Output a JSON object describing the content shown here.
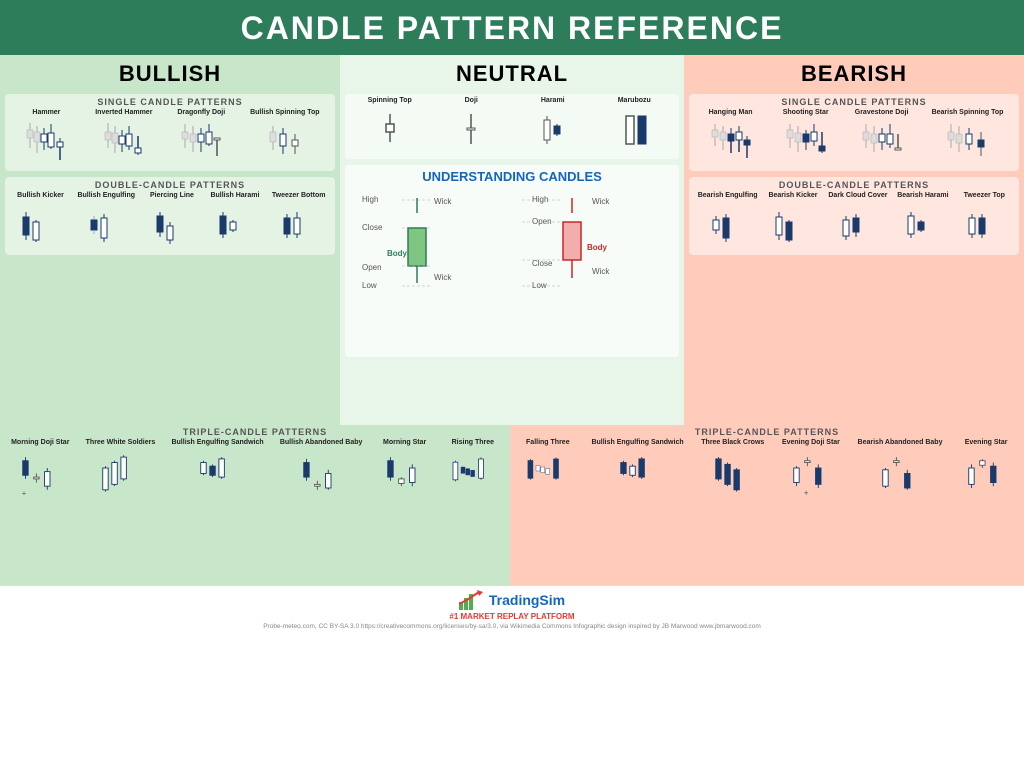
{
  "header": {
    "title": "CANDLE PATTERN REFERENCE"
  },
  "columns": {
    "bullish": {
      "label": "BULLISH",
      "single_title": "SINGLE CANDLE PATTERNS",
      "double_title": "DOUBLE-CANDLE PATTERNS",
      "single_patterns": [
        "Hammer",
        "Inverted Hammer",
        "Dragonfly Doji",
        "Bullish Spinning Top"
      ],
      "double_patterns": [
        "Bullish Kicker",
        "Bullish Engulfing",
        "Piercing Line",
        "Bullish Harami",
        "Tweezer Bottom"
      ]
    },
    "neutral": {
      "label": "NEUTRAL",
      "single_patterns": [
        "Spinning Top",
        "Doji",
        "Harami",
        "Marubozu"
      ],
      "understanding_title": "UNDERSTANDING CANDLES"
    },
    "bearish": {
      "label": "BEARISH",
      "single_title": "SINGLE CANDLE PATTERNS",
      "double_title": "DOUBLE-CANDLE PATTERNS",
      "single_patterns": [
        "Hanging Man",
        "Shooting Star",
        "Gravestone Doji",
        "Bearish Spinning Top"
      ],
      "double_patterns": [
        "Bearish Engulfing",
        "Bearish Kicker",
        "Dark Cloud Cover",
        "Bearish Harami",
        "Tweezer Top"
      ]
    }
  },
  "triple": {
    "bullish_title": "TRIPLE-CANDLE PATTERNS",
    "bearish_title": "TRIPLE-CANDLE PATTERNS",
    "bullish_patterns": [
      "Morning Doji Star",
      "Three White Soldiers",
      "Bullish Engulfing Sandwich",
      "Bullish Abandoned Baby",
      "Morning Star",
      "Rising Three"
    ],
    "bearish_patterns": [
      "Falling Three",
      "Bullish Engulfing Sandwich",
      "Three Black Crows",
      "Evening Doji Star",
      "Bearish Abandoned Baby",
      "Evening Star"
    ]
  },
  "footer": {
    "logo": "TradingSim",
    "tagline": "#1 MARKET REPLAY PLATFORM",
    "credits": "Probe-meteo.com, CC BY-SA 3.0 https://creativecommons.org/licenses/by-sa/3.0, via Wikimedia Commons    Infographic design inspired by JB Marwood www.jbmarwood.com"
  }
}
